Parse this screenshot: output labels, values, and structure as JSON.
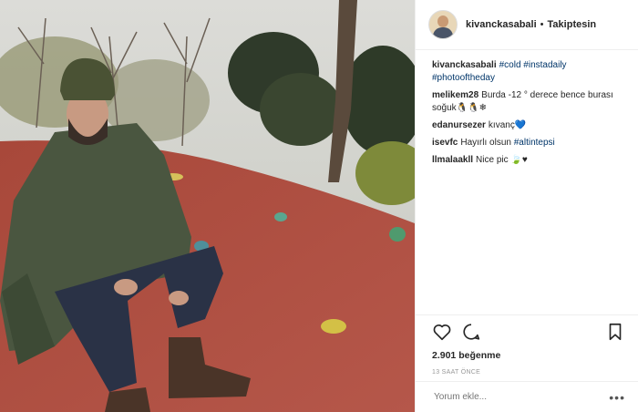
{
  "header": {
    "username": "kivanckasabali",
    "separator": "•",
    "follow_label": "Takiptesin"
  },
  "caption": {
    "username": "kivanckasabali",
    "tags": [
      "#cold",
      "#instadaily",
      "#photooftheday"
    ]
  },
  "comments": [
    {
      "user": "melikem28",
      "text": "Burda -12 ° derece bence burası soğuk🐧🐧❄"
    },
    {
      "user": "edanursezer",
      "text": "kıvanç💙"
    },
    {
      "user": "isevfc",
      "text": "Hayırlı olsun",
      "tag": "#altintepsi"
    },
    {
      "user": "llmalaakll",
      "text": "Nice pic 🍃♥"
    }
  ],
  "stats": {
    "likes": "2.901 beğenme",
    "time": "13 SAAT ÖNCE"
  },
  "comment_input": {
    "placeholder": "Yorum ekle..."
  },
  "icons": [
    "heart-icon",
    "comment-icon",
    "bookmark-icon",
    "more-icon"
  ],
  "colors": {
    "link": "#003569",
    "text": "#262626",
    "muted": "#999999"
  }
}
